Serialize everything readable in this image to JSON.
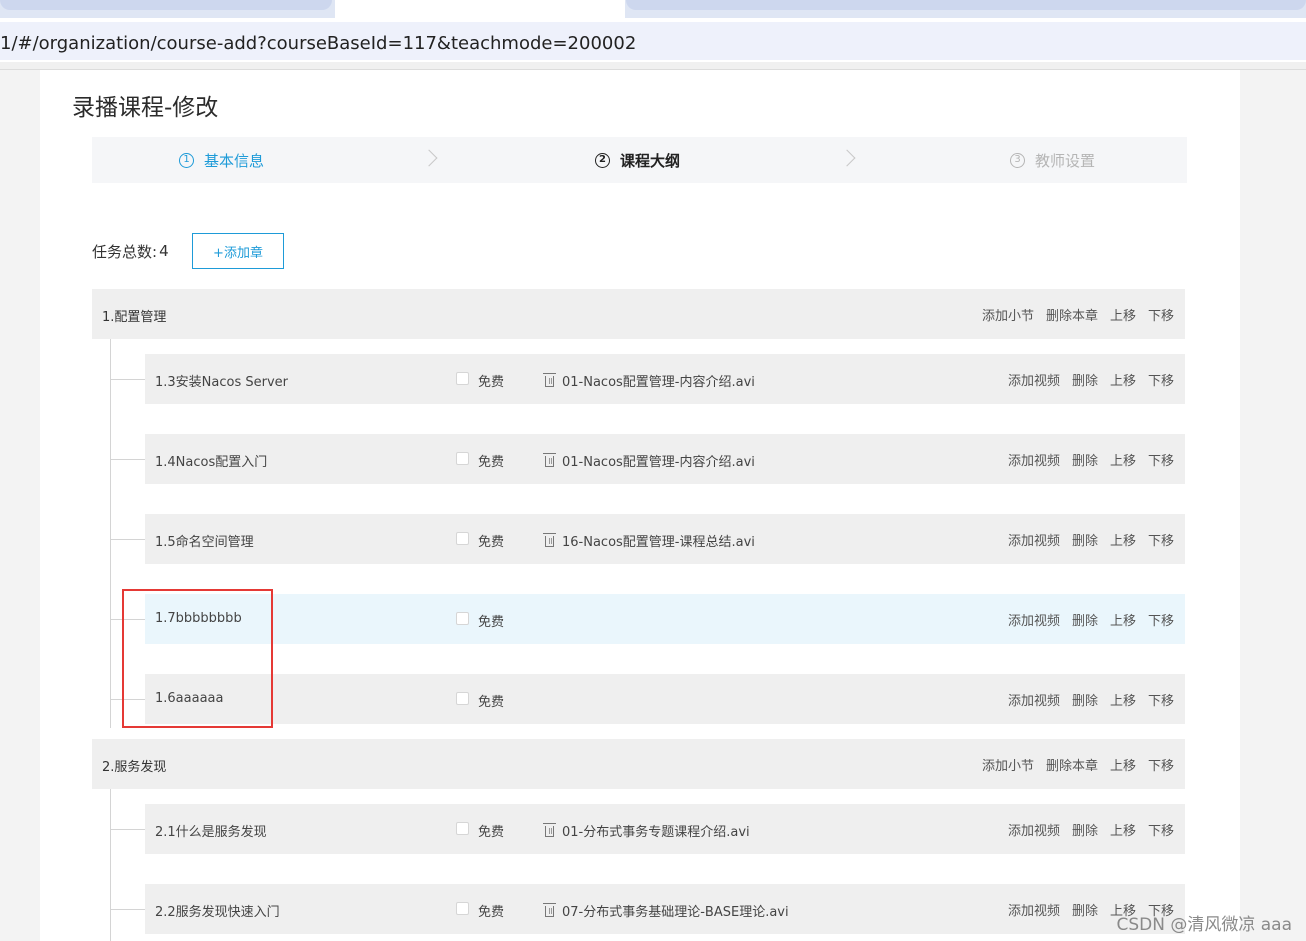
{
  "browser": {
    "url": "1/#/organization/course-add?courseBaseId=117&teachmode=200002"
  },
  "page": {
    "title": "录播课程-修改"
  },
  "steps": [
    {
      "num": "1",
      "label": "基本信息",
      "state": "done"
    },
    {
      "num": "2",
      "label": "课程大纲",
      "state": "active"
    },
    {
      "num": "3",
      "label": "教师设置",
      "state": "pending"
    }
  ],
  "tasks": {
    "label": "任务总数:",
    "count": "4",
    "add_chapter_label": "+添加章"
  },
  "chapter_actions": [
    "添加小节",
    "删除本章",
    "上移",
    "下移"
  ],
  "section_actions": [
    "添加视频",
    "删除",
    "上移",
    "下移"
  ],
  "free_label": "免费",
  "chapters": [
    {
      "title": "1.配置管理",
      "sections": [
        {
          "title": "1.3安装Nacos Server",
          "media": "01-Nacos配置管理-内容介绍.avi"
        },
        {
          "title": "1.4Nacos配置入门",
          "media": "01-Nacos配置管理-内容介绍.avi"
        },
        {
          "title": "1.5命名空间管理",
          "media": "16-Nacos配置管理-课程总结.avi"
        },
        {
          "title": "1.7bbbbbbbb",
          "media": ""
        },
        {
          "title": "1.6aaaaaa",
          "media": ""
        }
      ]
    },
    {
      "title": "2.服务发现",
      "sections": [
        {
          "title": "2.1什么是服务发现",
          "media": "01-分布式事务专题课程介绍.avi"
        },
        {
          "title": "2.2服务发现快速入门",
          "media": "07-分布式事务基础理论-BASE理论.avi"
        }
      ]
    }
  ],
  "watermark": "CSDN @清风微凉 aaa",
  "colors": {
    "accent": "#1e9bd8",
    "highlight_row": "#eaf6fc",
    "annotation_box": "#e53935"
  }
}
